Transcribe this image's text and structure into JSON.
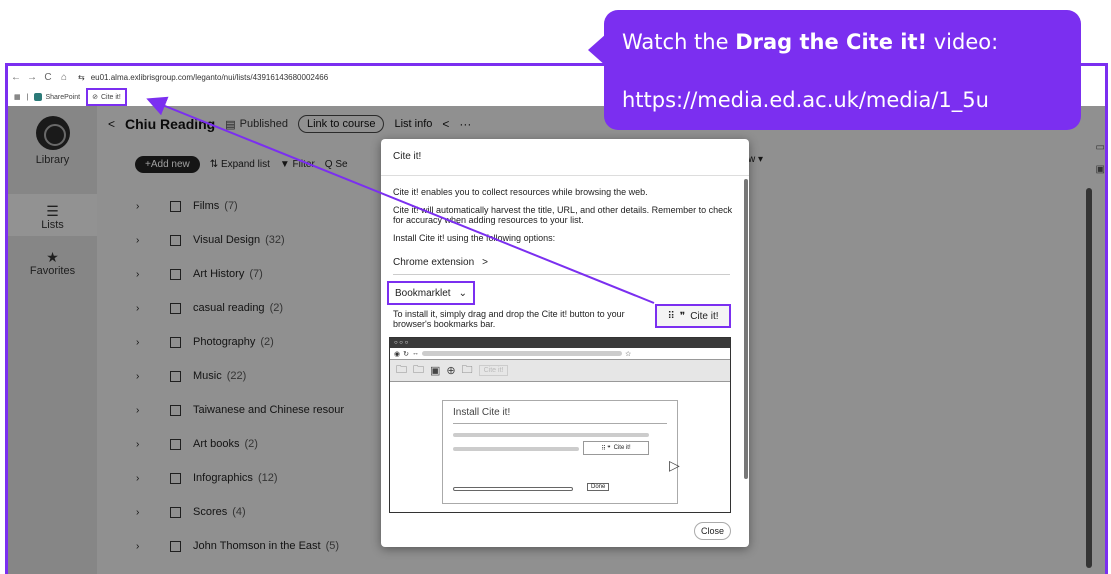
{
  "browser": {
    "nav": {
      "back": "←",
      "forward": "→",
      "reload": "C",
      "home": "⌂"
    },
    "url": "eu01.alma.exlibrisgroup.com/leganto/nui/lists/43916143680002466",
    "bookmarks": [
      {
        "label": "SharePoint"
      },
      {
        "label": "Cite it!"
      }
    ]
  },
  "rail": {
    "library": "Library",
    "lists": "Lists",
    "favorites": "Favorites"
  },
  "topbar": {
    "back": "<",
    "title": "Chiu Reading",
    "published": "Published",
    "link_course": "Link to course",
    "list_info": "List info",
    "more": "···"
  },
  "toolbar": {
    "add_new": "+Add new",
    "expand_list": "Expand list",
    "filter": "Filter",
    "search": "Q Se",
    "view": "w ▾"
  },
  "sections": [
    {
      "name": "Films",
      "count": "(7)"
    },
    {
      "name": "Visual Design",
      "count": "(32)"
    },
    {
      "name": "Art History",
      "count": "(7)"
    },
    {
      "name": "casual reading",
      "count": "(2)"
    },
    {
      "name": "Photography",
      "count": "(2)"
    },
    {
      "name": "Music",
      "count": "(22)"
    },
    {
      "name": "Taiwanese and Chinese resour",
      "count": ""
    },
    {
      "name": "Art books",
      "count": "(2)"
    },
    {
      "name": "Infographics",
      "count": "(12)"
    },
    {
      "name": "Scores",
      "count": "(4)"
    },
    {
      "name": "John Thomson in the East",
      "count": "(5)"
    }
  ],
  "dialog": {
    "title": "Cite it!",
    "intro": "Cite it! enables you to collect resources while browsing the web.",
    "harvest": "Cite it! will automatically harvest the title, URL, and other details. Remember to check for accuracy when adding resources to your list.",
    "install_options": "Install Cite it! using the following options:",
    "chrome_ext": "Chrome extension",
    "chrome_chevron": ">",
    "bookmarklet": "Bookmarklet",
    "bookmarklet_chevron": "⌄",
    "drag_instructions": "To install it, simply drag and drop the Cite it! button to your browser's bookmarks bar.",
    "cite_button": "Cite it!",
    "close": "Close",
    "illustration": {
      "dots": "○ ○ ○",
      "bm_ghost": "Cite it!",
      "card_title": "Install Cite it!",
      "cite_small": "Cite it!",
      "done": "Done"
    }
  },
  "callout": {
    "line1_prefix": "Watch the ",
    "line1_bold": "Drag the Cite it!",
    "line1_suffix": " video:",
    "line2": "https://media.ed.ac.uk/media/1_5u"
  },
  "colors": {
    "accent": "#7b2ff0"
  },
  "icons": [
    "back-icon",
    "forward-icon",
    "reload-icon",
    "home-icon",
    "grid-icon",
    "sharepoint-icon",
    "citeit-icon",
    "list-icon",
    "star-icon",
    "share-icon",
    "chevron-right-icon",
    "checkbox-icon",
    "cursor-icon"
  ]
}
